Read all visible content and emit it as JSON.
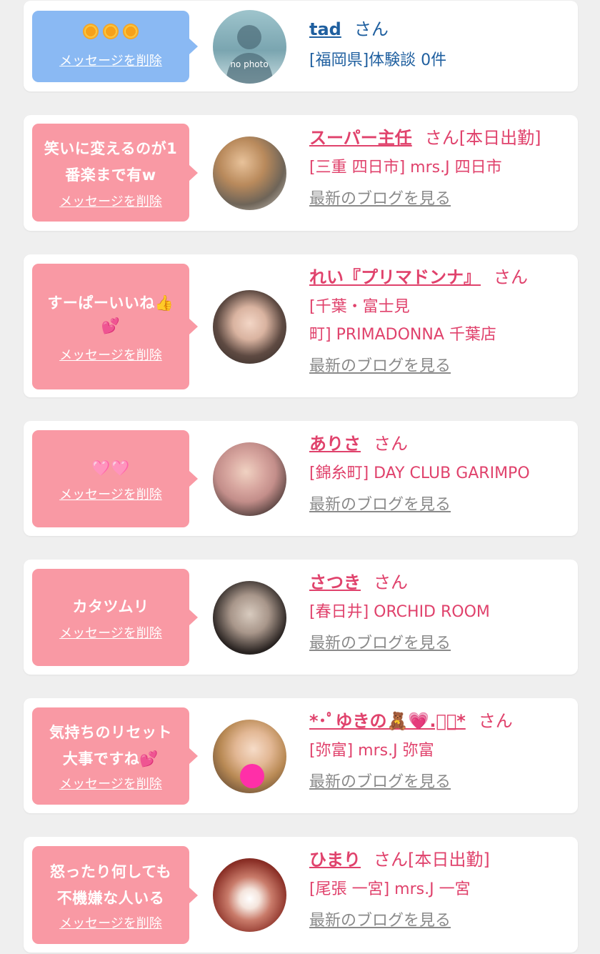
{
  "delete_label": "メッセージを削除",
  "san": "さん",
  "blog_label": "最新のブログを見る",
  "items": [
    {
      "message": "🌞🌞🌞",
      "name": "tad",
      "suffix": "",
      "shop_lines": [
        "[福岡県]体験談 0件"
      ],
      "avatar_text": "no photo",
      "has_blog": false,
      "theme": "blue"
    },
    {
      "message_lines": [
        "笑いに変えるのが1",
        "番楽まで有w"
      ],
      "name": "スーパー主任",
      "suffix": "[本日出勤]",
      "shop_lines": [
        "[三重 四日市] mrs.J 四日市"
      ],
      "has_blog": true,
      "theme": "pink"
    },
    {
      "message_lines": [
        "すーぱーいいね👍",
        "💕"
      ],
      "name": "れい『プリマドンナ』",
      "suffix": "",
      "shop_lines": [
        "[千葉・富士見",
        "町] PRIMADONNA 千葉店"
      ],
      "has_blog": true,
      "theme": "pink"
    },
    {
      "message_lines": [
        "🩷🩷"
      ],
      "name": "ありさ",
      "suffix": "",
      "shop_lines": [
        "[錦糸町] DAY CLUB GARIMPO"
      ],
      "has_blog": true,
      "theme": "pink"
    },
    {
      "message_lines": [
        "カタツムリ"
      ],
      "name": "さつき",
      "suffix": "",
      "shop_lines": [
        "[春日井] ORCHID ROOM"
      ],
      "has_blog": true,
      "theme": "pink"
    },
    {
      "message_lines": [
        "気持ちのリセット",
        "大事ですね💕"
      ],
      "name": "*･ﾟゆきの🧸💗.ﾟ･*",
      "suffix": "",
      "shop_lines": [
        "[弥富] mrs.J 弥富"
      ],
      "has_blog": true,
      "theme": "pink"
    },
    {
      "message_lines": [
        "怒ったり何しても",
        "不機嫌な人いる"
      ],
      "name": "ひまり",
      "suffix": "[本日出勤]",
      "shop_lines": [
        "[尾張 一宮] mrs.J 一宮"
      ],
      "has_blog": true,
      "theme": "pink"
    }
  ],
  "colors": {
    "pink_bubble": "#f999a4",
    "blue_bubble": "#8ab9f3",
    "pink_text": "#e0426c",
    "blue_text": "#1f5f9f",
    "blog_text": "#8a8a8a"
  }
}
